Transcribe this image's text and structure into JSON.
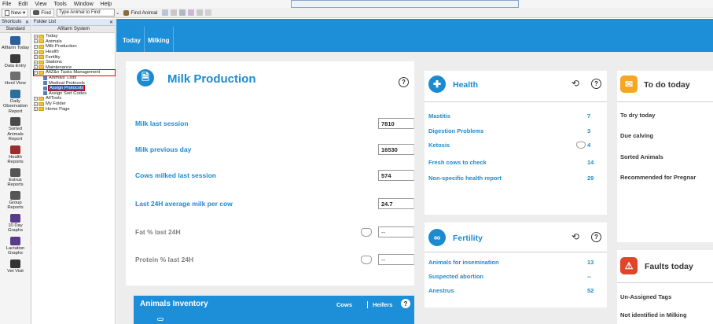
{
  "menu": [
    "File",
    "Edit",
    "View",
    "Tools",
    "Window",
    "Help"
  ],
  "toolbar": {
    "new_label": "New",
    "find_label": "Find",
    "search_value": "Type Animal to Find",
    "find_animal_label": "Find Animal"
  },
  "shortcuts": {
    "header": "Shortcuts",
    "subheader": "Standard",
    "items": [
      {
        "label": "Afifarm Today"
      },
      {
        "label": "Data Entry"
      },
      {
        "label": "Herd View"
      },
      {
        "label": "Daily Observation Report"
      },
      {
        "label": "Sorted Animals Report"
      },
      {
        "label": "Health Reports"
      },
      {
        "label": "Estrus Reports"
      },
      {
        "label": "Group Reports"
      },
      {
        "label": "10 Day Graphs"
      },
      {
        "label": "Lactation Graphs"
      },
      {
        "label": "Vet Visit"
      }
    ]
  },
  "folder": {
    "header": "Folder List",
    "subheader": "Afifarm System",
    "nodes": [
      {
        "label": "Today"
      },
      {
        "label": "Animals"
      },
      {
        "label": "Milk Production"
      },
      {
        "label": "Health"
      },
      {
        "label": "Fertility"
      },
      {
        "label": "Stations"
      },
      {
        "label": "Maintenance"
      },
      {
        "label": "AfiZ&n Tasks Management"
      },
      {
        "label": "Animals' Lists"
      },
      {
        "label": "Medical Protocols"
      },
      {
        "label": "Assign Protocols"
      },
      {
        "label": "Assign Sort Codes"
      },
      {
        "label": "AfiTools"
      },
      {
        "label": "My Folder"
      },
      {
        "label": "Home Page"
      }
    ]
  },
  "tabs": [
    {
      "label": "Today"
    },
    {
      "label": "Milking"
    }
  ],
  "milk": {
    "title": "Milk Production",
    "help": "?",
    "rows": [
      {
        "label": "Milk last session",
        "value": "7810"
      },
      {
        "label": "Milk previous day",
        "value": "16530"
      },
      {
        "label": "Cows milked last session",
        "value": "574"
      },
      {
        "label": "Last 24H average milk per cow",
        "value": "24.7"
      },
      {
        "label": "Fat % last 24H",
        "value": "--"
      },
      {
        "label": "Protein % last 24H",
        "value": "--"
      }
    ]
  },
  "inventory": {
    "title": "Animals Inventory",
    "cows": "Cows",
    "heifers": "Heifers",
    "help": "?"
  },
  "health": {
    "title": "Health",
    "help": "?",
    "rows": [
      {
        "label": "Mastitis",
        "value": "7"
      },
      {
        "label": "Digestion Problems",
        "value": "3"
      },
      {
        "label": "Ketosis",
        "value": "4"
      },
      {
        "label": "Fresh cows to check",
        "value": "14"
      },
      {
        "label": "Non-specific health report",
        "value": "29"
      }
    ]
  },
  "fertility": {
    "title": "Fertility",
    "help": "?",
    "rows": [
      {
        "label": "Animals for insemination",
        "value": "13"
      },
      {
        "label": "Suspected abortion",
        "value": "--"
      },
      {
        "label": "Anestrus",
        "value": "52"
      }
    ]
  },
  "todo": {
    "title": "To do today",
    "rows": [
      {
        "label": "To dry today"
      },
      {
        "label": "Due calving"
      },
      {
        "label": "Sorted Animals"
      },
      {
        "label": "Recommended for Pregnar"
      }
    ]
  },
  "faults": {
    "title": "Faults today",
    "rows": [
      {
        "label": "Un-Assigned Tags"
      },
      {
        "label": "Not identified in Milking"
      }
    ]
  },
  "colors": {
    "accent": "#1d8ed8",
    "orange": "#f5a623",
    "red": "#e0452b"
  }
}
